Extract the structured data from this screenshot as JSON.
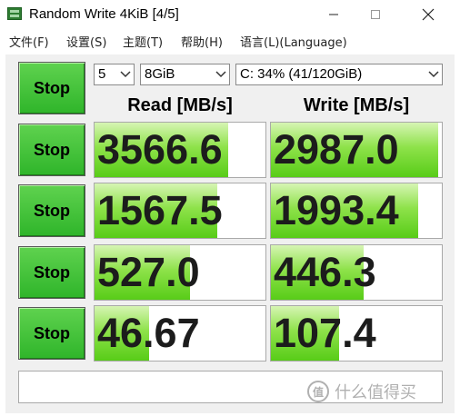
{
  "window": {
    "title": "Random Write 4KiB [4/5]"
  },
  "menu": [
    {
      "label": "文件(F)"
    },
    {
      "label": "设置(S)"
    },
    {
      "label": "主题(T)"
    },
    {
      "label": "帮助(H)"
    },
    {
      "label": "语言(L)(Language)"
    }
  ],
  "controls": {
    "main_button": "Stop",
    "count": "5",
    "size": "8GiB",
    "drive": "C: 34% (41/120GiB)"
  },
  "headers": {
    "read": "Read [MB/s]",
    "write": "Write [MB/s]"
  },
  "rows": [
    {
      "button": "Stop",
      "read": "3566.6",
      "write": "2987.0",
      "read_fill": 0.78,
      "write_fill": 0.98
    },
    {
      "button": "Stop",
      "read": "1567.5",
      "write": "1993.4",
      "read_fill": 0.72,
      "write_fill": 0.86
    },
    {
      "button": "Stop",
      "read": "527.0",
      "write": "446.3",
      "read_fill": 0.56,
      "write_fill": 0.54
    },
    {
      "button": "Stop",
      "read": "46.67",
      "write": "107.4",
      "read_fill": 0.32,
      "write_fill": 0.4
    }
  ],
  "comment": "",
  "watermark": {
    "logo": "值",
    "text": "什么值得买"
  },
  "colors": {
    "button_green": "#3cc035",
    "bar_green": "#8ee24a",
    "panel_bg": "#f0f0f0"
  }
}
